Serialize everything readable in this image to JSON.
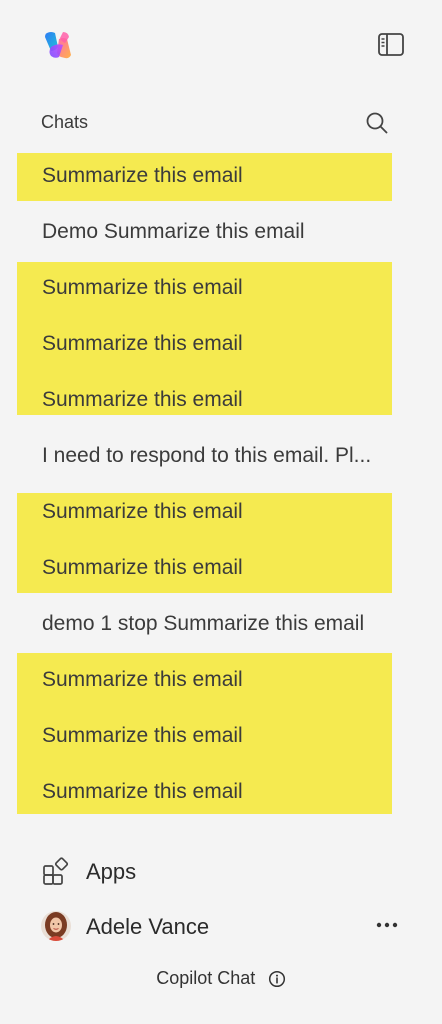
{
  "sidebar": {
    "logo_icon": "copilot-logo-icon",
    "toggle_icon": "panel-toggle-icon",
    "chats_label": "Chats",
    "search_icon": "search-icon",
    "highlight_color": "#f5ea50",
    "chats": [
      {
        "label": "Summarize this email",
        "highlighted": true
      },
      {
        "label": "Demo Summarize this email",
        "highlighted": false
      },
      {
        "label": "Summarize this email",
        "highlighted": true
      },
      {
        "label": "Summarize this email",
        "highlighted": true
      },
      {
        "label": "Summarize this email",
        "highlighted": true
      },
      {
        "label": "I need to respond to this email. Pl...",
        "highlighted": false
      },
      {
        "label": "Summarize this email",
        "highlighted": true
      },
      {
        "label": "Summarize this email",
        "highlighted": true
      },
      {
        "label": "demo 1 stop Summarize this email",
        "highlighted": false
      },
      {
        "label": "Summarize this email",
        "highlighted": true
      },
      {
        "label": "Summarize this email",
        "highlighted": true
      },
      {
        "label": "Summarize this email",
        "highlighted": true
      }
    ],
    "apps_label": "Apps",
    "apps_icon": "apps-icon",
    "user_name": "Adele Vance",
    "avatar_icon": "avatar",
    "more_icon": "more-options-icon",
    "footer_label": "Copilot Chat",
    "footer_icon": "info-icon"
  }
}
